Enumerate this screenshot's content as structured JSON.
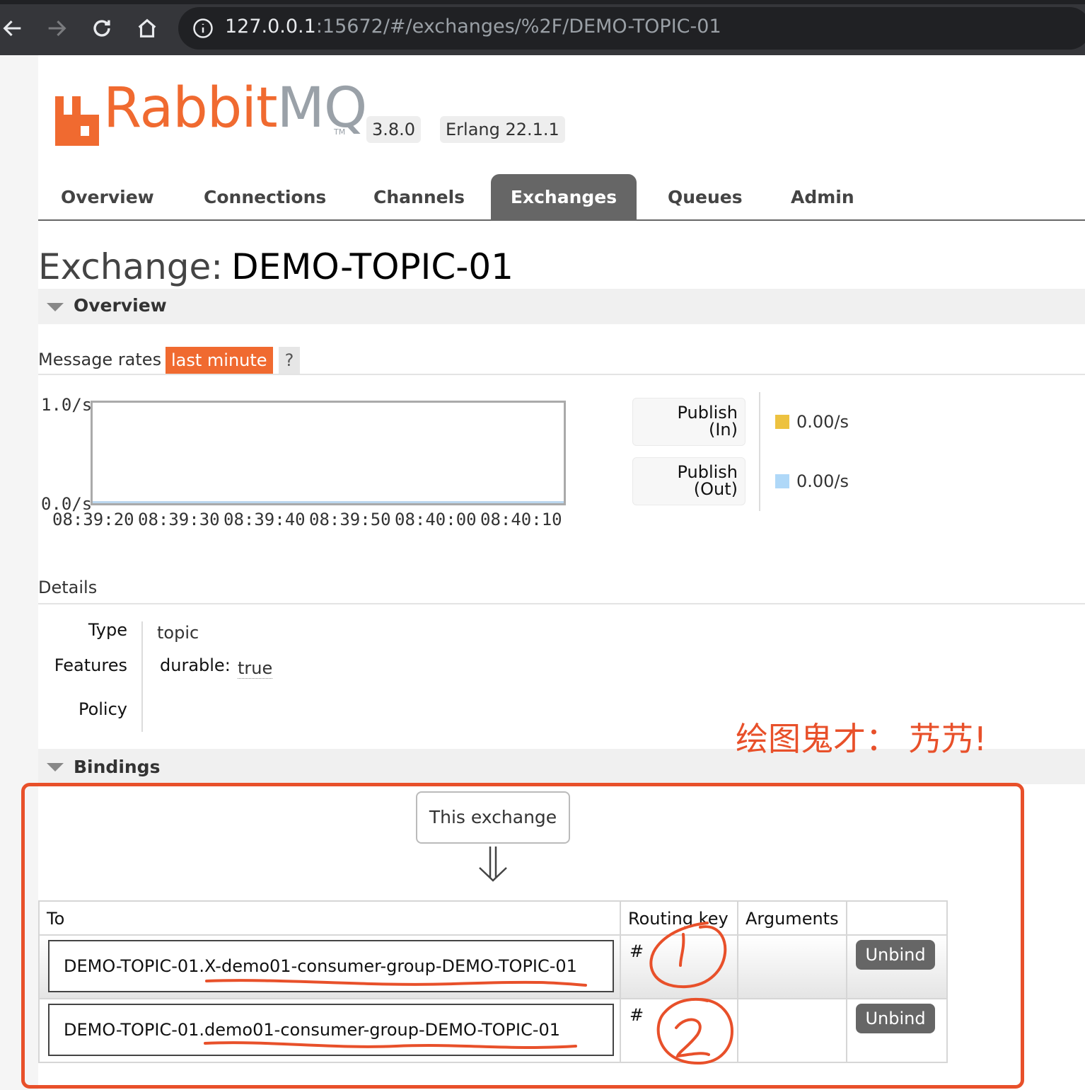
{
  "browser": {
    "url_host": "127.0.0.1",
    "url_rest": ":15672/#/exchanges/%2F/DEMO-TOPIC-01"
  },
  "header": {
    "logo_rabbit": "Rabbit",
    "logo_mq": "MQ",
    "logo_tm": "TM",
    "version": "3.8.0",
    "erlang": "Erlang 22.1.1"
  },
  "tabs": [
    "Overview",
    "Connections",
    "Channels",
    "Exchanges",
    "Queues",
    "Admin"
  ],
  "active_tab": "Exchanges",
  "page": {
    "title_prefix": "Exchange:",
    "title_name": "DEMO-TOPIC-01"
  },
  "overview": {
    "section_label": "Overview",
    "rates_label": "Message rates",
    "rates_range": "last minute",
    "help": "?"
  },
  "chart_data": {
    "type": "line",
    "x": [
      "08:39:20",
      "08:39:30",
      "08:39:40",
      "08:39:50",
      "08:40:00",
      "08:40:10"
    ],
    "y_ticks": [
      "1.0/s",
      "0.0/s"
    ],
    "ylim": [
      0,
      1
    ],
    "series": [
      {
        "name": "Publish (In)",
        "values": [
          0,
          0,
          0,
          0,
          0,
          0
        ],
        "color": "#edc240"
      },
      {
        "name": "Publish (Out)",
        "values": [
          0,
          0,
          0,
          0,
          0,
          0
        ],
        "color": "#afd8f8"
      }
    ],
    "legend": [
      {
        "line1": "Publish",
        "line2": "(In)",
        "value": "0.00/s",
        "color": "#edc240"
      },
      {
        "line1": "Publish",
        "line2": "(Out)",
        "value": "0.00/s",
        "color": "#afd8f8"
      }
    ]
  },
  "details": {
    "heading": "Details",
    "type_key": "Type",
    "type_value": "topic",
    "features_key": "Features",
    "durable_key": "durable:",
    "durable_value": "true",
    "policy_key": "Policy"
  },
  "annotation": {
    "text": "绘图鬼才：  艿艿!",
    "color": "#e8502a"
  },
  "bindings": {
    "section_label": "Bindings",
    "source_label": "This exchange",
    "columns": [
      "To",
      "Routing key",
      "Arguments",
      ""
    ],
    "rows": [
      {
        "to": "DEMO-TOPIC-01.X-demo01-consumer-group-DEMO-TOPIC-01",
        "routing_key": "#",
        "arguments": "",
        "action": "Unbind"
      },
      {
        "to": "DEMO-TOPIC-01.demo01-consumer-group-DEMO-TOPIC-01",
        "routing_key": "#",
        "arguments": "",
        "action": "Unbind"
      }
    ]
  }
}
